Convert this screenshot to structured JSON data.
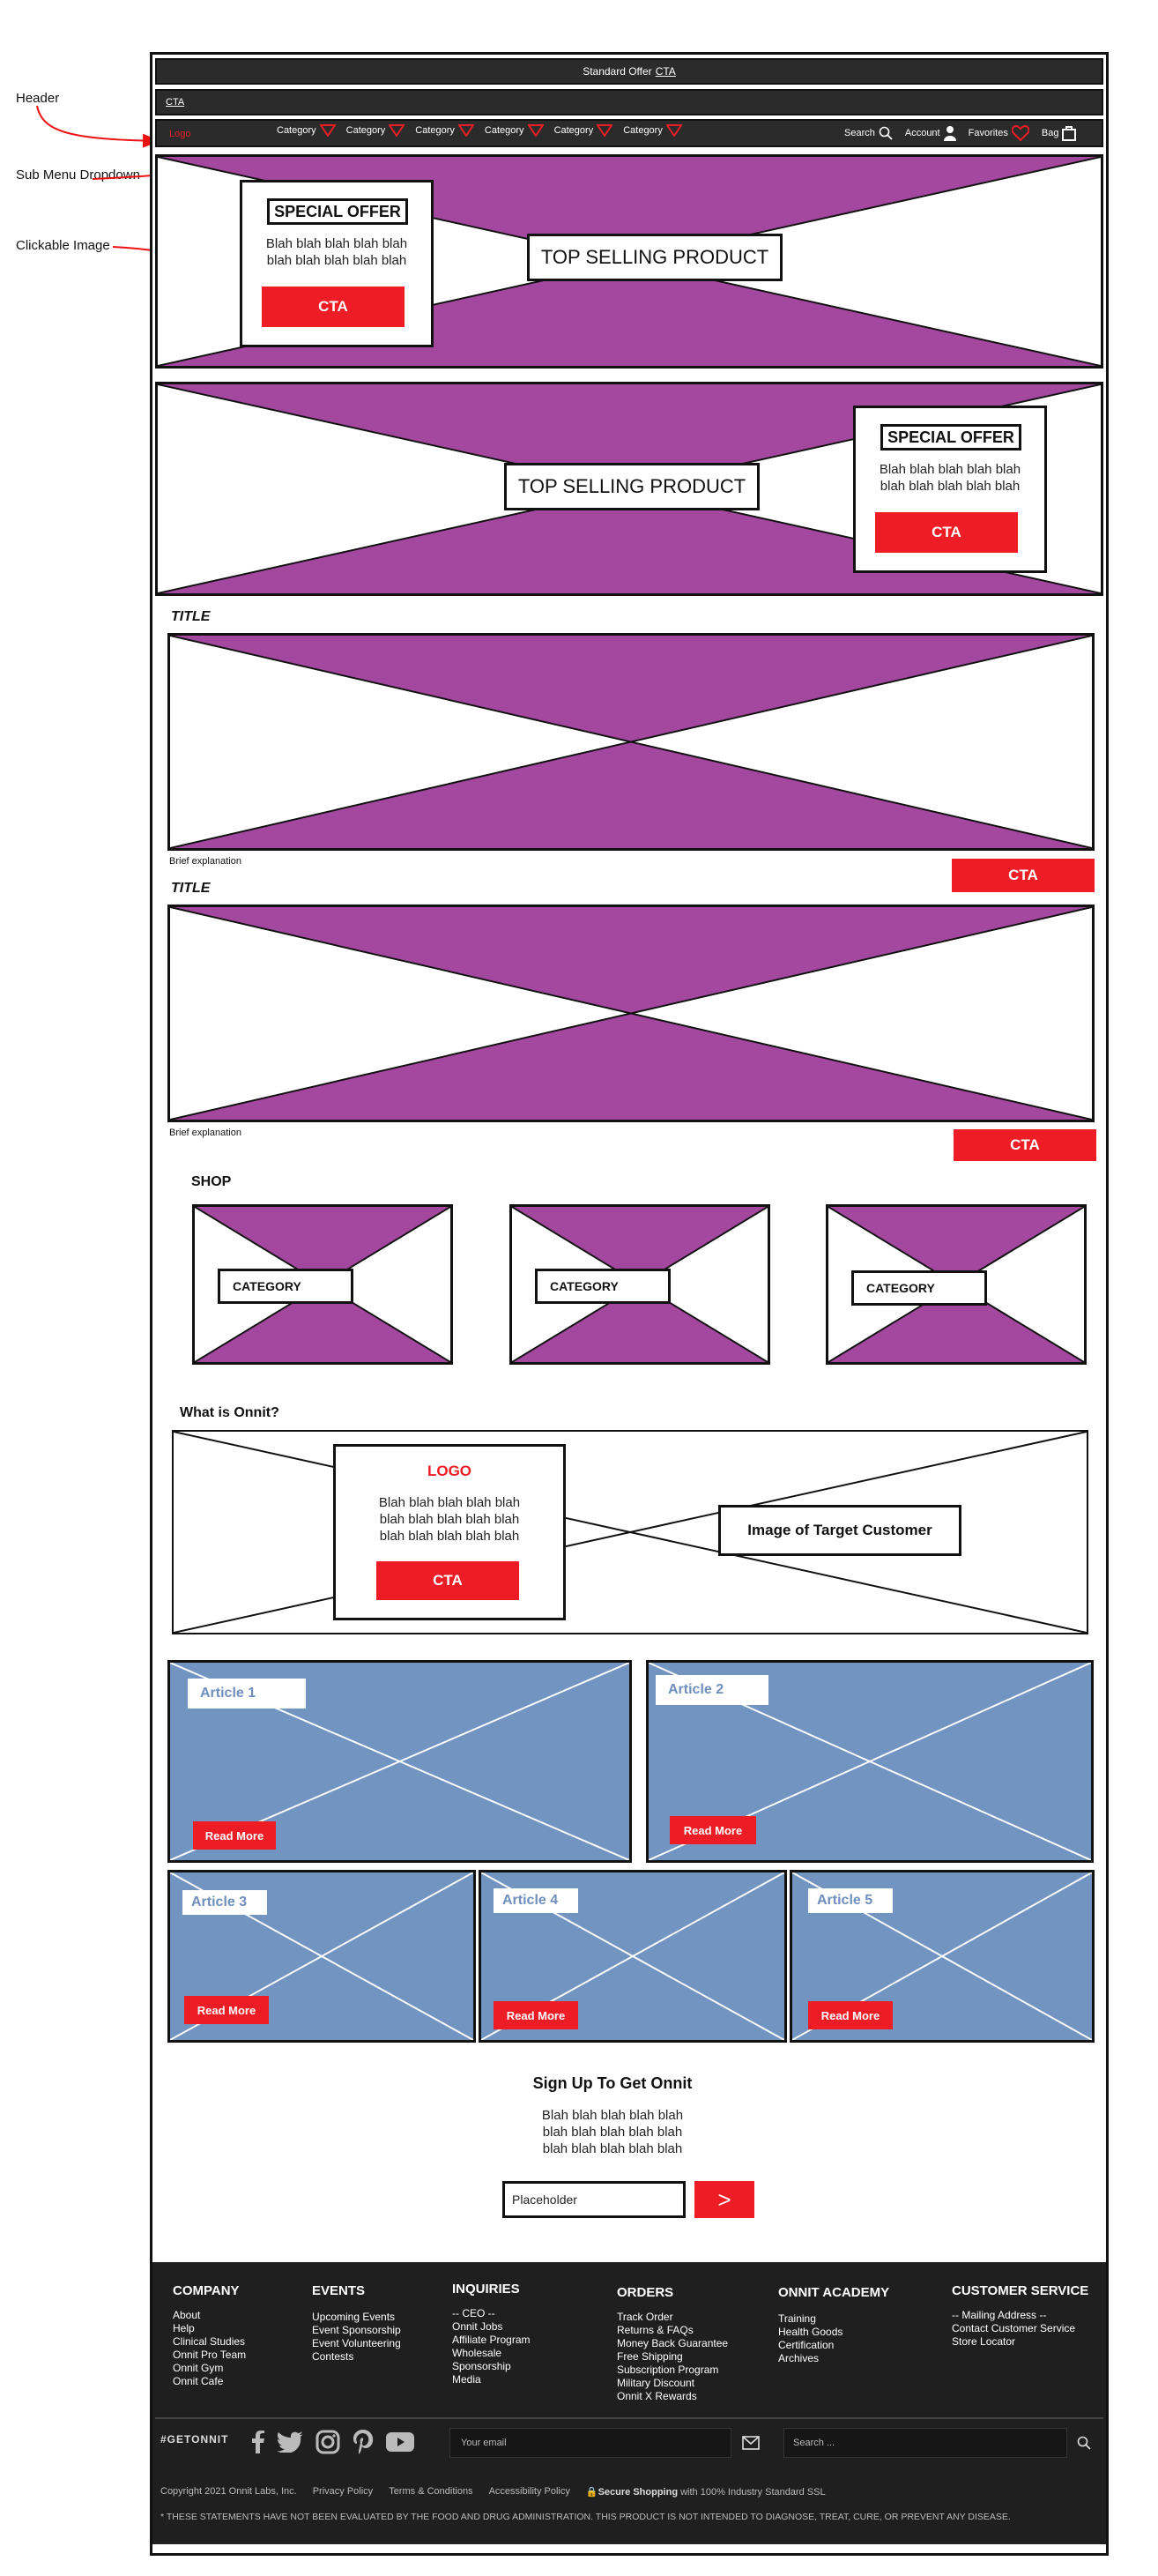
{
  "annotations": {
    "header": "Header",
    "submenu": "Sub Menu Dropdown",
    "clickable": "Clickable Image"
  },
  "promo_bar": {
    "text": "Standard Offer",
    "cta": "CTA"
  },
  "secondary_bar": {
    "cta": "CTA"
  },
  "nav": {
    "logo": "Logo",
    "categories": [
      "Category",
      "Category",
      "Category",
      "Category",
      "Category",
      "Category"
    ],
    "search": "Search",
    "account": "Account",
    "favorites": "Favorites",
    "bag": "Bag"
  },
  "hero1": {
    "offer_title": "SPECIAL OFFER",
    "offer_body": [
      "Blah blah blah blah blah",
      "blah  blah blah blah blah"
    ],
    "offer_cta": "CTA",
    "product": "TOP SELLING PRODUCT"
  },
  "hero2": {
    "product": "TOP SELLING PRODUCT",
    "offer_title": "SPECIAL OFFER",
    "offer_body": [
      "Blah blah blah blah blah",
      "blah  blah blah blah blah"
    ],
    "offer_cta": "CTA"
  },
  "feature1": {
    "title": "TITLE",
    "explanation": "Brief explanation",
    "cta": "CTA"
  },
  "feature2": {
    "title": "TITLE",
    "explanation": "Brief explanation",
    "cta": "CTA"
  },
  "shop": {
    "heading": "SHOP",
    "categories": [
      "CATEGORY",
      "CATEGORY",
      "CATEGORY"
    ]
  },
  "about": {
    "heading": "What is Onnit?",
    "logo": "LOGO",
    "body": [
      "Blah blah blah blah blah",
      "blah  blah blah blah blah",
      "blah  blah blah blah blah"
    ],
    "cta": "CTA",
    "target": "Image of Target Customer"
  },
  "articles": [
    {
      "title": "Article 1",
      "button": "Read More"
    },
    {
      "title": "Article 2",
      "button": "Read More"
    },
    {
      "title": "Article 3",
      "button": "Read More"
    },
    {
      "title": "Article 4",
      "button": "Read More"
    },
    {
      "title": "Article 5",
      "button": "Read More"
    }
  ],
  "signup": {
    "heading": "Sign Up To Get Onnit",
    "body": [
      "Blah blah blah blah blah",
      "blah  blah blah blah blah",
      "blah  blah blah blah blah"
    ],
    "placeholder": "Placeholder",
    "submit": ">"
  },
  "footer": {
    "columns": [
      {
        "heading": "COMPANY",
        "links": [
          "About",
          "Help",
          "Clinical Studies",
          "Onnit Pro Team",
          "Onnit Gym",
          "Onnit Cafe"
        ]
      },
      {
        "heading": "EVENTS",
        "links": [
          "Upcoming Events",
          "Event Sponsorship",
          "Event Volunteering",
          "Contests"
        ]
      },
      {
        "heading": "INQUIRIES",
        "links": [
          "-- CEO --",
          "Onnit Jobs",
          "Affiliate Program",
          "Wholesale",
          "Sponsorship",
          "Media"
        ]
      },
      {
        "heading": "ORDERS",
        "links": [
          "Track Order",
          "Returns & FAQs",
          "Money Back Guarantee",
          "Free Shipping",
          "Subscription Program",
          "Military Discount",
          "Onnit X Rewards"
        ]
      },
      {
        "heading": "ONNIT ACADEMY",
        "links": [
          "Training",
          "Health Goods",
          "Certification",
          "Archives"
        ]
      },
      {
        "heading": "CUSTOMER SERVICE",
        "links": [
          "-- Mailing Address --",
          "Contact Customer Service",
          "Store Locator"
        ]
      }
    ],
    "hashtag": "#GETONNIT",
    "email_placeholder": "Your email",
    "search_placeholder": "Search ...",
    "copyright": "Copyright 2021 Onnit Labs, Inc.",
    "privacy": "Privacy Policy",
    "terms": "Terms & Conditions",
    "accessibility": "Accessibility Policy",
    "secure_bold": "Secure Shopping",
    "secure_rest": "with 100% Industry Standard SSL",
    "disclaimer": "* THESE STATEMENTS HAVE NOT BEEN EVALUATED BY THE FOOD AND DRUG ADMINISTRATION. THIS PRODUCT IS NOT INTENDED TO DIAGNOSE, TREAT, CURE, OR PREVENT ANY DISEASE."
  },
  "colors": {
    "accent": "#ee1c25",
    "placeholder_fill": "#a3479f",
    "article_fill": "#7194c1",
    "bar": "#2b2b2b",
    "footer": "#1f1f1f"
  }
}
